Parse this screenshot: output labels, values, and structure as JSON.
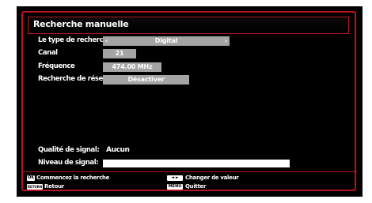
{
  "title": "Recherche manuelle",
  "rows": {
    "search_type": {
      "label": "Le type de recherche",
      "value": "Digital",
      "left_arrow": "‹",
      "right_arrow": "›"
    },
    "channel": {
      "label": "Canal",
      "value": "21"
    },
    "frequency": {
      "label": "Fréquence",
      "value": "474.00 MHz"
    },
    "network_search": {
      "label": "Recherche de réseau",
      "value": "Désactiver"
    }
  },
  "signal": {
    "quality_label": "Qualité de signal:",
    "quality_value": "Aucun",
    "level_label": "Niveau de signal:",
    "level_fraction": 1.0
  },
  "footer": {
    "ok_key": "OK",
    "ok_text": "Commencez la recherche",
    "return_key": "RETURN",
    "return_text": "Retour",
    "arrows_key": "◄ ►",
    "arrows_text": "Changer de valeur",
    "menu_key": "MENU",
    "menu_text": "Quitter"
  },
  "colors": {
    "accent": "#b3151b",
    "field_bg": "#a4a4a4",
    "background": "#000000"
  }
}
